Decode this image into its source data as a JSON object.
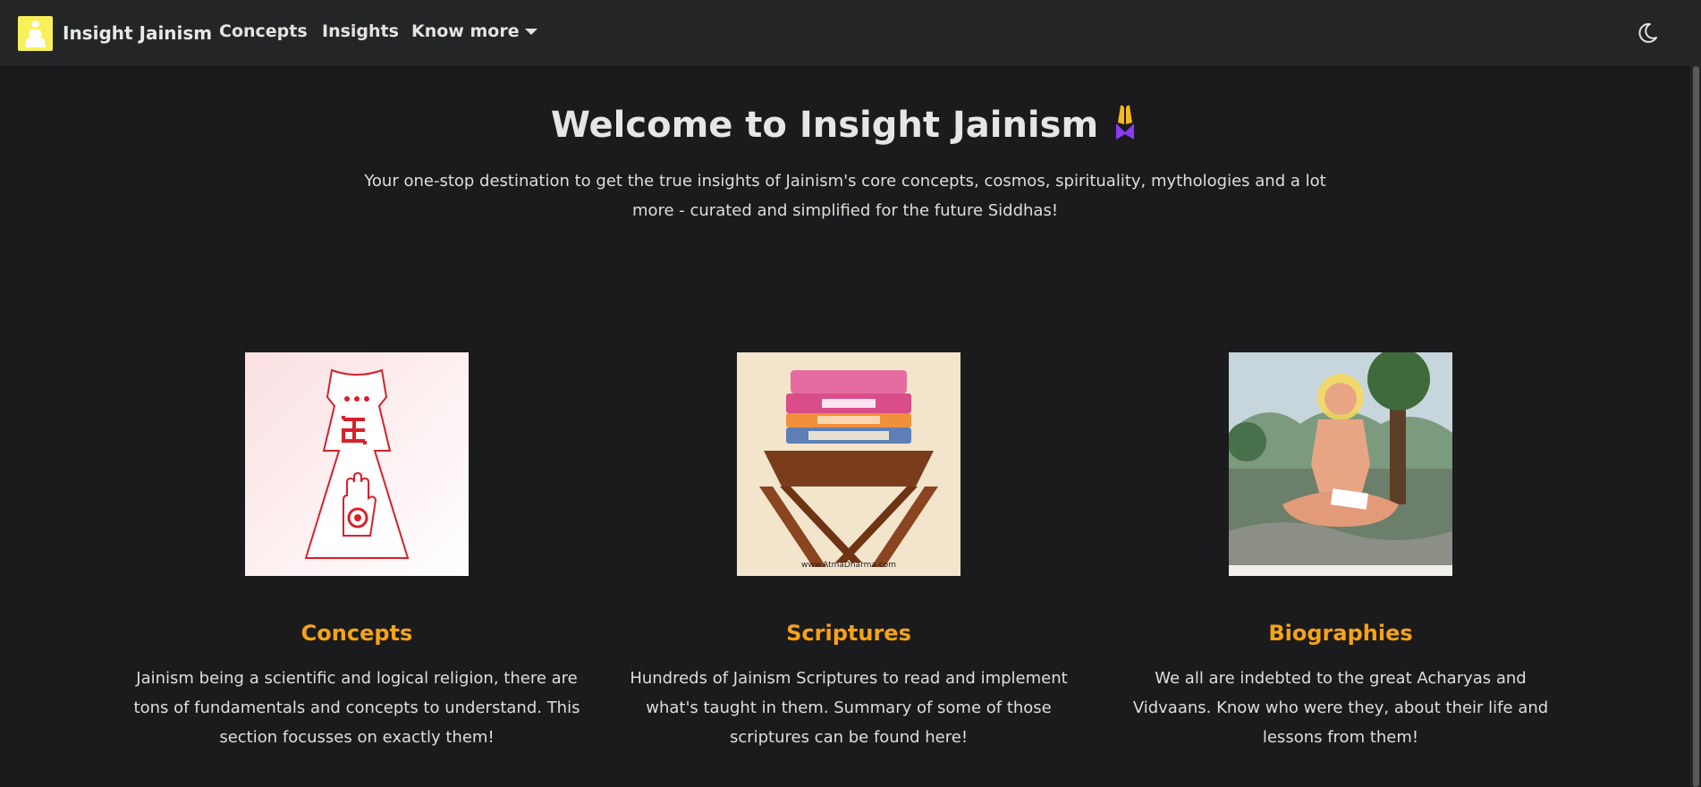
{
  "navbar": {
    "brand": "Insight Jainism",
    "links": [
      {
        "label": "Concepts"
      },
      {
        "label": "Insights"
      },
      {
        "label": "Know more"
      }
    ]
  },
  "hero": {
    "title": "Welcome to Insight Jainism",
    "emoji_icon": "folded-hands-icon",
    "subtitle": "Your one-stop destination to get the true insights of Jainism's core concepts, cosmos, spirituality, mythologies and a lot more - curated and simplified for the future Siddhas!"
  },
  "cards": [
    {
      "title": "Concepts",
      "text": "Jainism being a scientific and logical religion, there are tons of fundamentals and concepts to understand. This section focusses on exactly them!",
      "image": "jain-symbol-image"
    },
    {
      "title": "Scriptures",
      "text": "Hundreds of Jainism Scriptures to read and implement what's taught in them. Summary of some of those scriptures can be found here!",
      "image": "scriptures-books-image",
      "image_caption": "www.AtmaDharma.com"
    },
    {
      "title": "Biographies",
      "text": "We all are indebted to the great Acharyas and Vidvaans. Know who were they, about their life and lessons from them!",
      "image": "acharya-portrait-image"
    }
  ],
  "colors": {
    "background": "#1b1b1d",
    "navbar": "#242526",
    "accent": "#f5a316"
  }
}
